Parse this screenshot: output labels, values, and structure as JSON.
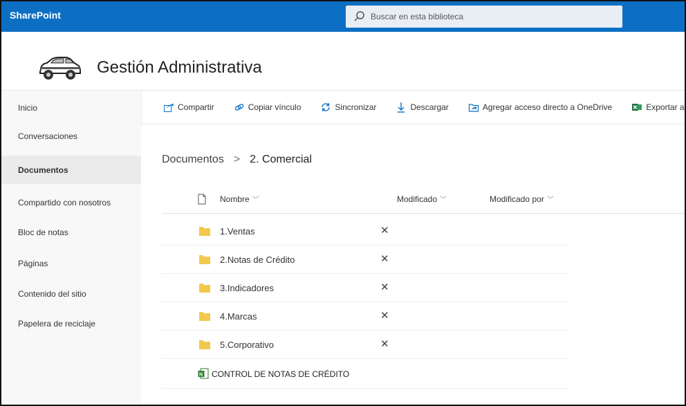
{
  "topbar": {
    "brand": "SharePoint",
    "search_placeholder": "Buscar en esta biblioteca",
    "colors": {
      "bar": "#0d6fc3",
      "search_bg": "#e9eef5"
    }
  },
  "site": {
    "title": "Gestión Administrativa",
    "logo_icon": "car-icon"
  },
  "nav": {
    "items": [
      {
        "label": "Inicio"
      },
      {
        "label": "Conversaciones"
      },
      {
        "label": "Documentos",
        "active": true
      },
      {
        "label": "Compartido con nosotros"
      },
      {
        "label": "Bloc de notas"
      },
      {
        "label": "Páginas"
      },
      {
        "label": "Contenido del sitio"
      },
      {
        "label": "Papelera de reciclaje"
      }
    ]
  },
  "toolbar": {
    "share": {
      "label": "Compartir",
      "icon": "share-icon"
    },
    "copy_link": {
      "label": "Copiar vínculo",
      "icon": "link-icon"
    },
    "sync": {
      "label": "Sincronizar",
      "icon": "sync-icon"
    },
    "download": {
      "label": "Descargar",
      "icon": "download-icon"
    },
    "onedrive": {
      "label": "Agregar acceso directo a OneDrive",
      "icon": "onedrive-shortcut-icon"
    },
    "excel": {
      "label": "Exportar a Excel",
      "icon": "excel-icon"
    },
    "more": "·"
  },
  "breadcrumb": {
    "root": "Documentos",
    "separator": ">",
    "current": "2. Comercial"
  },
  "list": {
    "columns": {
      "name": "Nombre",
      "modified": "Modificado",
      "modified_by": "Modificado por"
    },
    "folders": [
      {
        "name": "1.Ventas",
        "status": "✕"
      },
      {
        "name": "2.Notas de Crédito",
        "status": "✕"
      },
      {
        "name": "3.Indicadores",
        "status": "✕"
      },
      {
        "name": "4.Marcas",
        "status": "✕"
      },
      {
        "name": "5.Corporativo",
        "status": "✕"
      }
    ],
    "files": [
      {
        "name": "CONTROL DE NOTAS DE CRÉDITO",
        "icon": "onenote-icon"
      }
    ]
  }
}
